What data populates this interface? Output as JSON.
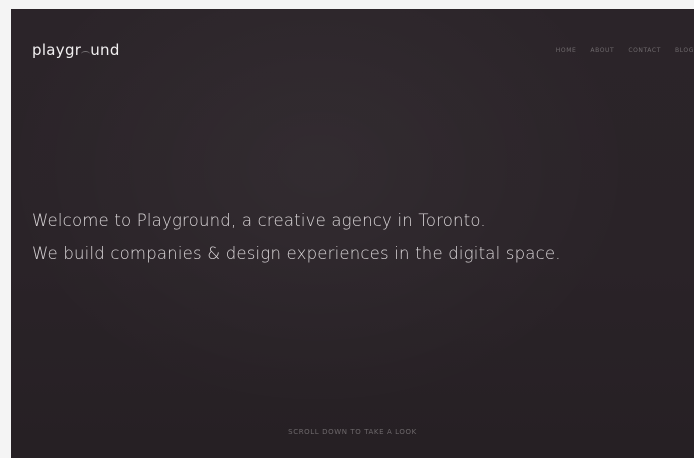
{
  "brand": {
    "logo_part1": "playgr",
    "logo_part2": "und"
  },
  "nav": {
    "items": [
      {
        "label": "HOME"
      },
      {
        "label": "ABOUT"
      },
      {
        "label": "CONTACT"
      },
      {
        "label": "BLOG"
      }
    ]
  },
  "hero": {
    "line1": "Welcome to Playground, a creative agency in Toronto.",
    "line2": "We build companies & design experiences in the digital space."
  },
  "footer": {
    "scroll_cta": "SCROLL DOWN TO TAKE A LOOK"
  },
  "colors": {
    "background": "#2a2328",
    "text_primary": "#e8e4e6",
    "text_muted": "#6d686b"
  }
}
